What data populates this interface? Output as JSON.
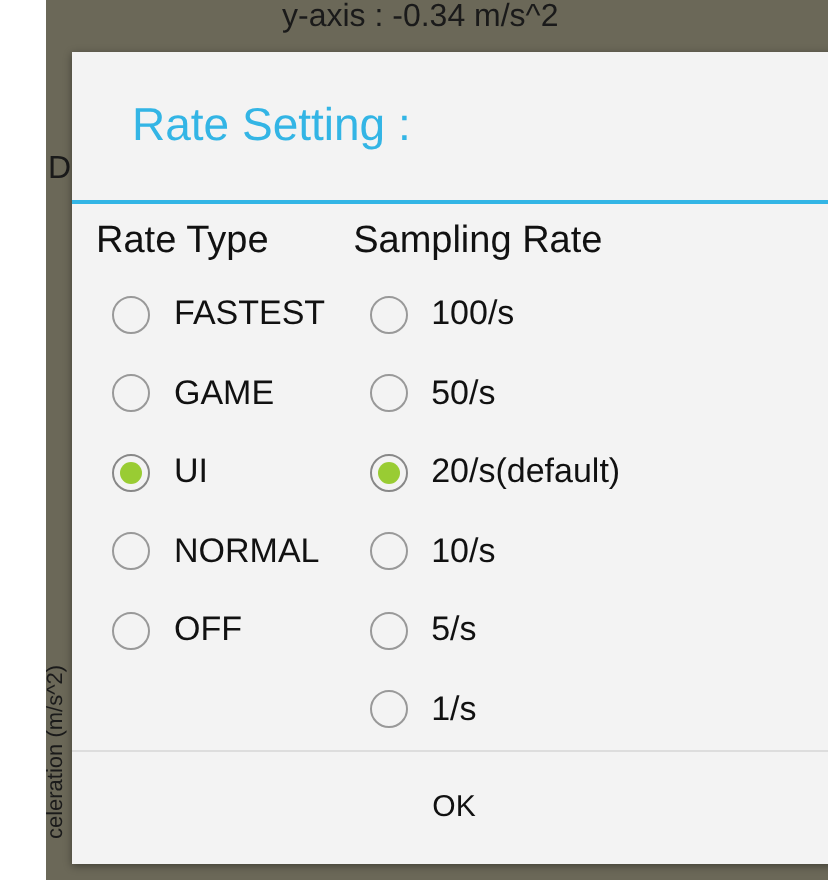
{
  "background": {
    "reading": "y-axis : -0.34 m/s^2",
    "side_letter": "D",
    "axis_label": "celeration (m/s^2)"
  },
  "dialog": {
    "title": "Rate Setting :",
    "groups": [
      {
        "heading": "Rate Type",
        "options": [
          {
            "label": "FASTEST",
            "selected": false
          },
          {
            "label": "GAME",
            "selected": false
          },
          {
            "label": "UI",
            "selected": true
          },
          {
            "label": "NORMAL",
            "selected": false
          },
          {
            "label": "OFF",
            "selected": false
          }
        ]
      },
      {
        "heading": "Sampling Rate",
        "options": [
          {
            "label": "100/s",
            "selected": false
          },
          {
            "label": "50/s",
            "selected": false
          },
          {
            "label": "20/s(default)",
            "selected": true
          },
          {
            "label": "10/s",
            "selected": false
          },
          {
            "label": "5/s",
            "selected": false
          },
          {
            "label": "1/s",
            "selected": false
          }
        ]
      }
    ],
    "button": "OK"
  }
}
